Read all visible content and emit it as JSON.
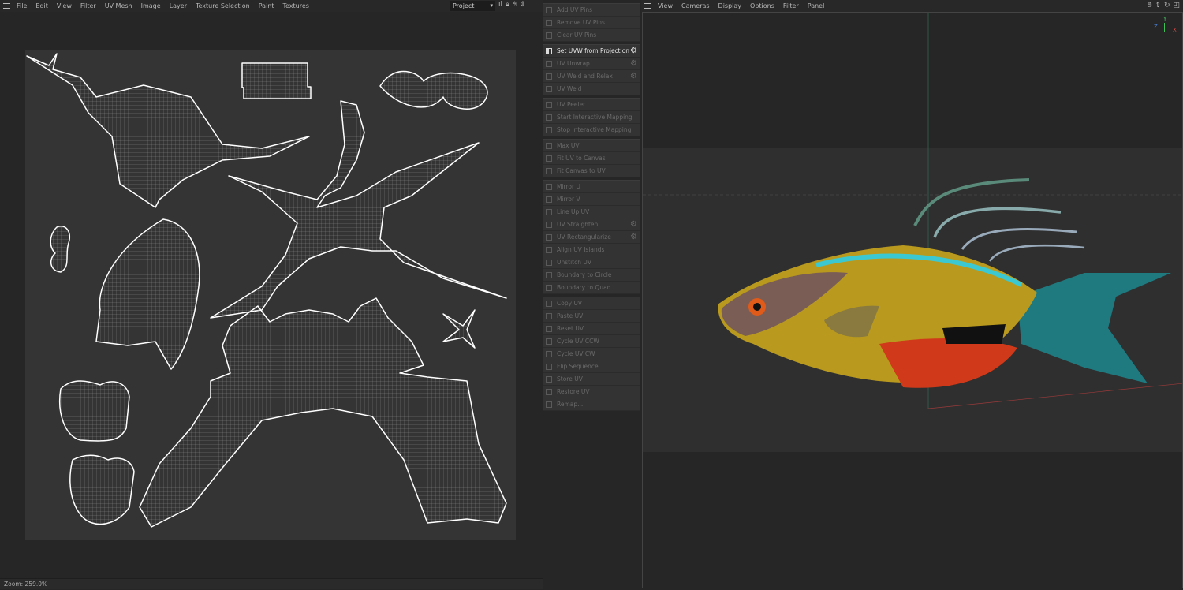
{
  "uv_editor": {
    "menu": [
      "File",
      "Edit",
      "View",
      "Filter",
      "UV Mesh",
      "Image",
      "Layer",
      "Texture Selection",
      "Paint",
      "Textures"
    ],
    "project_select": "Project",
    "toolbar_icons": [
      "histogram-icon",
      "lock-icon",
      "hand-icon",
      "move-icon"
    ],
    "status": "Zoom: 259.0%"
  },
  "commands": {
    "groups": [
      [
        {
          "label": "Add UV Pins"
        },
        {
          "label": "Remove UV Pins"
        },
        {
          "label": "Clear UV Pins"
        }
      ],
      [
        {
          "label": "Set UVW from Projection",
          "active": true,
          "gear": true
        },
        {
          "label": "UV Unwrap",
          "gear": true
        },
        {
          "label": "UV Weld and Relax",
          "gear": true
        },
        {
          "label": "UV Weld"
        }
      ],
      [
        {
          "label": "UV Peeler"
        },
        {
          "label": "Start Interactive Mapping"
        },
        {
          "label": "Stop Interactive Mapping"
        }
      ],
      [
        {
          "label": "Max UV"
        },
        {
          "label": "Fit UV to Canvas"
        },
        {
          "label": "Fit Canvas to UV"
        }
      ],
      [
        {
          "label": "Mirror U"
        },
        {
          "label": "Mirror V"
        },
        {
          "label": "Line Up UV"
        },
        {
          "label": "UV Straighten",
          "gear": true
        },
        {
          "label": "UV Rectangularize",
          "gear": true
        },
        {
          "label": "Align UV Islands"
        },
        {
          "label": "Unstitch UV"
        },
        {
          "label": "Boundary to Circle"
        },
        {
          "label": "Boundary to Quad"
        }
      ],
      [
        {
          "label": "Copy UV"
        },
        {
          "label": "Paste UV"
        },
        {
          "label": "Reset UV"
        },
        {
          "label": "Cycle UV CCW"
        },
        {
          "label": "Cycle UV CW"
        },
        {
          "label": "Flip Sequence"
        },
        {
          "label": "Store UV"
        },
        {
          "label": "Restore UV"
        },
        {
          "label": "Remap..."
        }
      ]
    ]
  },
  "viewport": {
    "menu": [
      "View",
      "Cameras",
      "Display",
      "Options",
      "Filter",
      "Panel"
    ],
    "axes": {
      "y": "Y",
      "z": "Z",
      "x": "X"
    },
    "colors": {
      "y": "#3fbf5a",
      "z": "#4a7fd0",
      "x": "#d04848"
    }
  }
}
